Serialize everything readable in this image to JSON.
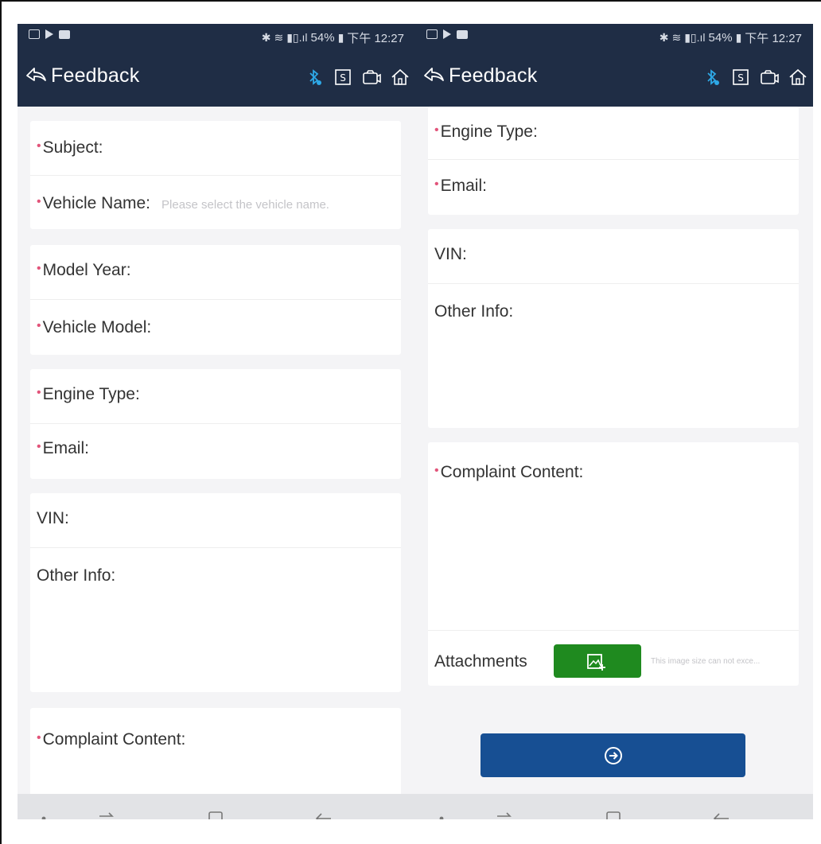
{
  "status_bar": {
    "battery": "54%",
    "time": "下午 12:27"
  },
  "app_bar": {
    "title": "Feedback"
  },
  "form": {
    "subject_label": "Subject:",
    "vehicle_name_label": "Vehicle Name:",
    "vehicle_name_placeholder": "Please select the vehicle name.",
    "model_year_label": "Model Year:",
    "vehicle_model_label": "Vehicle Model:",
    "engine_type_label": "Engine Type:",
    "email_label": "Email:",
    "vin_label": "VIN:",
    "other_info_label": "Other Info:",
    "complaint_label": "Complaint Content:",
    "attachments_label": "Attachments",
    "attachments_hint": "This image size can not exce..."
  },
  "icons": {
    "back": "back-arrow-icon",
    "bluetooth": "bluetooth-icon",
    "s_tile": "s-tile-icon",
    "camera": "camera-icon",
    "home": "home-icon",
    "add_image": "add-image-icon",
    "submit": "arrow-circle-right-icon",
    "nav_dot": "dot-icon",
    "nav_recent": "recent-apps-icon",
    "nav_home": "home-square-icon",
    "nav_back": "back-icon"
  },
  "colors": {
    "app_bar": "#1f2d45",
    "required_mark": "#e2547a",
    "attach_button": "#1f8a1f",
    "submit_button": "#174f93",
    "bluetooth_accent": "#2ea8e6",
    "page_bg": "#f4f4f6"
  }
}
